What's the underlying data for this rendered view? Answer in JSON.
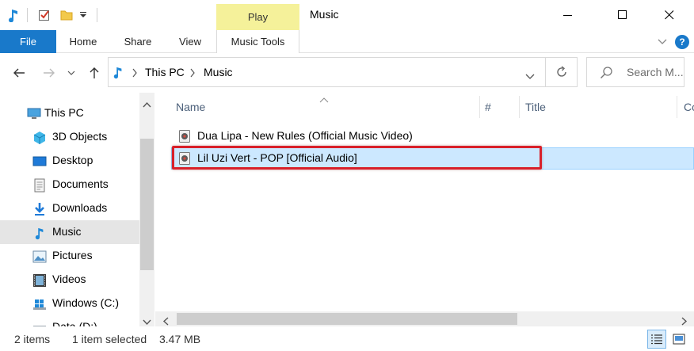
{
  "window": {
    "title": "Music",
    "context_tab": "Play",
    "controls": {
      "minimize": "minimize-icon",
      "maximize": "maximize-icon",
      "close": "close-icon"
    }
  },
  "ribbon": {
    "tabs": [
      "File",
      "Home",
      "Share",
      "View",
      "Music Tools"
    ],
    "help": "?"
  },
  "address": {
    "crumbs": [
      "This PC",
      "Music"
    ],
    "search_placeholder": "Search M..."
  },
  "nav_pane": {
    "items": [
      {
        "label": "This PC",
        "icon": "this-pc-icon"
      },
      {
        "label": "3D Objects",
        "icon": "3d-objects-icon"
      },
      {
        "label": "Desktop",
        "icon": "desktop-icon"
      },
      {
        "label": "Documents",
        "icon": "documents-icon"
      },
      {
        "label": "Downloads",
        "icon": "downloads-icon"
      },
      {
        "label": "Music",
        "icon": "music-icon",
        "selected": true
      },
      {
        "label": "Pictures",
        "icon": "pictures-icon"
      },
      {
        "label": "Videos",
        "icon": "videos-icon"
      },
      {
        "label": "Windows (C:)",
        "icon": "drive-icon"
      },
      {
        "label": "Data (D:)",
        "icon": "drive-icon"
      }
    ]
  },
  "content": {
    "columns": [
      "Name",
      "#",
      "Title",
      "Co"
    ],
    "files": [
      {
        "name": "Dua Lipa - New Rules (Official Music Video)",
        "selected": false
      },
      {
        "name": "Lil Uzi Vert - POP [Official Audio]",
        "selected": true
      }
    ]
  },
  "status": {
    "item_count": "2 items",
    "selected": "1 item selected",
    "size": "3.47 MB"
  },
  "colors": {
    "file_tab": "#1979ca",
    "play_context": "#f5f19a",
    "selection": "#cce8ff",
    "highlight_box": "#d8202a"
  }
}
